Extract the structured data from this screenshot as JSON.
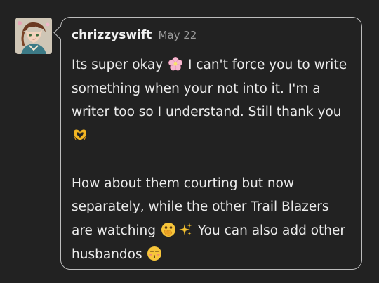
{
  "message": {
    "username": "chrizzyswift",
    "date": "May 22",
    "paragraph1": {
      "text_a": "Its super okay",
      "emoji_a": "cherry-blossom-icon",
      "text_b": "I can't force you to write something when your not into it. I'm a writer too so I understand. Still thank you",
      "emoji_b": "heart-hands-icon"
    },
    "paragraph2": {
      "text_a": "How about them courting but now separately, while the other Trail Blazers are watching",
      "emoji_a": "face-with-open-eyes-hand-over-mouth-icon",
      "emoji_b": "sparkles-icon",
      "text_b": "You can also add other husbandos",
      "emoji_c": "kissing-face-icon"
    }
  },
  "colors": {
    "background": "#222222",
    "bubble_border": "#bdbdbd",
    "text": "#ececec",
    "date": "#9c9c9c"
  }
}
